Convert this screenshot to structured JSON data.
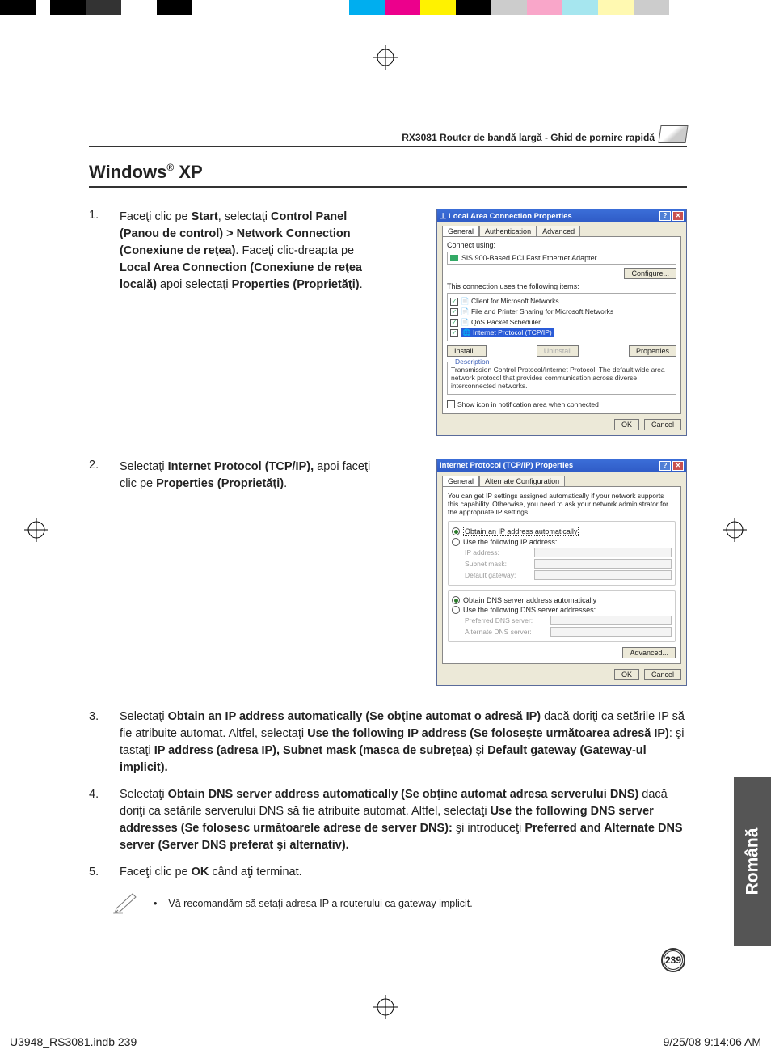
{
  "colorbar": [
    "#000000",
    "#ffffff",
    "#000000",
    "#333333",
    "#ffffff",
    "#000000",
    "#ffffff",
    "#ffffff",
    "#00aeef",
    "#ec008c",
    "#fff200",
    "#000000",
    "#cccccc",
    "#f9a6c9",
    "#a6e6ef",
    "#fff9b1",
    "#cccccc"
  ],
  "header": {
    "text": "RX3081 Router de bandă largă - Ghid de pornire rapidă"
  },
  "section_title_pre": "Windows",
  "section_title_suf": "XP",
  "section_title_reg": "®",
  "step1": {
    "num": "1.",
    "text_parts": [
      {
        "t": "Faceţi clic pe ",
        "b": false
      },
      {
        "t": "Start",
        "b": true
      },
      {
        "t": ", selectaţi ",
        "b": false
      },
      {
        "t": "Control Panel (Panou de control) > Network Connection (Conexiune de reţea)",
        "b": true
      },
      {
        "t": ". Faceţi clic-dreapta pe ",
        "b": false
      },
      {
        "t": "Local Area Connection (Conexiune de reţea locală)",
        "b": true
      },
      {
        "t": " apoi selectaţi ",
        "b": false
      },
      {
        "t": "Properties (Proprietăţi)",
        "b": true
      },
      {
        "t": ".",
        "b": false
      }
    ]
  },
  "dialog1": {
    "title": "Local Area Connection Properties",
    "tabs": [
      "General",
      "Authentication",
      "Advanced"
    ],
    "connect_label": "Connect using:",
    "adapter": "SiS 900-Based PCI Fast Ethernet Adapter",
    "configure_btn": "Configure...",
    "uses_label": "This connection uses the following items:",
    "items": [
      "Client for Microsoft Networks",
      "File and Printer Sharing for Microsoft Networks",
      "QoS Packet Scheduler",
      "Internet Protocol (TCP/IP)"
    ],
    "install_btn": "Install...",
    "uninstall_btn": "Uninstall",
    "properties_btn": "Properties",
    "desc_label": "Description",
    "desc_text": "Transmission Control Protocol/Internet Protocol. The default wide area network protocol that provides communication across diverse interconnected networks.",
    "show_icon": "Show icon in notification area when connected",
    "ok": "OK",
    "cancel": "Cancel"
  },
  "step2": {
    "num": "2.",
    "text_parts": [
      {
        "t": "Selectaţi ",
        "b": false
      },
      {
        "t": "Internet Protocol (TCP/IP),",
        "b": true
      },
      {
        "t": " apoi faceţi clic pe ",
        "b": false
      },
      {
        "t": "Properties (Proprietăţi)",
        "b": true
      },
      {
        "t": ".",
        "b": false
      }
    ]
  },
  "dialog2": {
    "title": "Internet Protocol (TCP/IP) Properties",
    "tabs": [
      "General",
      "Alternate Configuration"
    ],
    "intro": "You can get IP settings assigned automatically if your network supports this capability. Otherwise, you need to ask your network administrator for the appropriate IP settings.",
    "r1": "Obtain an IP address automatically",
    "r2": "Use the following IP address:",
    "f_ip": "IP address:",
    "f_mask": "Subnet mask:",
    "f_gw": "Default gateway:",
    "r3": "Obtain DNS server address automatically",
    "r4": "Use the following DNS server addresses:",
    "f_pd": "Preferred DNS server:",
    "f_ad": "Alternate DNS server:",
    "adv_btn": "Advanced...",
    "ok": "OK",
    "cancel": "Cancel"
  },
  "step3": {
    "num": "3.",
    "text_parts": [
      {
        "t": "Selectaţi ",
        "b": false
      },
      {
        "t": "Obtain an IP address automatically (Se obţine automat o adresă IP)",
        "b": true
      },
      {
        "t": " dacă doriţi ca setările IP să fie atribuite automat. Altfel, selectaţi ",
        "b": false
      },
      {
        "t": "Use the following IP address (Se foloseşte următoarea adresă IP)",
        "b": true
      },
      {
        "t": ": şi tastaţi ",
        "b": false
      },
      {
        "t": "IP address (adresa IP), Subnet mask (masca de subreţea)",
        "b": true
      },
      {
        "t": " şi ",
        "b": false
      },
      {
        "t": "Default gateway (Gateway-ul implicit).",
        "b": true
      }
    ]
  },
  "step4": {
    "num": "4.",
    "text_parts": [
      {
        "t": "Selectaţi ",
        "b": false
      },
      {
        "t": "Obtain DNS server address automatically (Se obţine automat adresa serverului DNS)",
        "b": true
      },
      {
        "t": " dacă doriţi ca setările serverului DNS să fie atribuite automat. Altfel, selectaţi ",
        "b": false
      },
      {
        "t": "Use the following DNS server addresses (Se folosesc următoarele adrese de server DNS):",
        "b": true
      },
      {
        "t": " şi introduceţi ",
        "b": false
      },
      {
        "t": "Preferred and Alternate DNS server (Server DNS preferat şi alternativ).",
        "b": true
      }
    ]
  },
  "step5": {
    "num": "5.",
    "text_parts": [
      {
        "t": "Faceţi clic pe ",
        "b": false
      },
      {
        "t": "OK",
        "b": true
      },
      {
        "t": " când aţi terminat.",
        "b": false
      }
    ]
  },
  "note": {
    "bullet": "•",
    "text": "Vă recomandăm să setaţi adresa IP a routerului ca gateway implicit."
  },
  "side_tab": "Română",
  "page_number": "239",
  "footer": {
    "left": "U3948_RS3081.indb   239",
    "right": "9/25/08   9:14:06 AM"
  }
}
